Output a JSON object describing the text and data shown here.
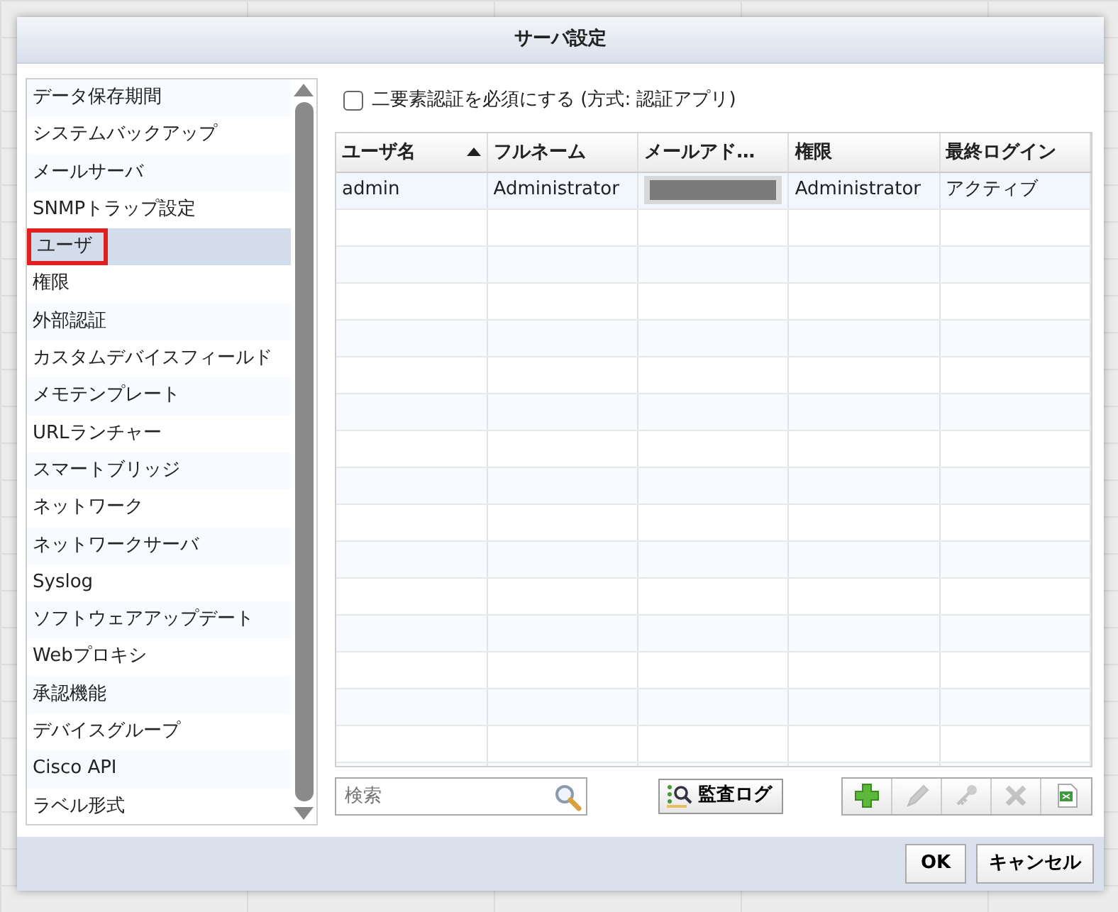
{
  "dialog": {
    "title": "サーバ設定"
  },
  "sidebar": {
    "items": [
      {
        "label": "データ保存期間",
        "selected": false,
        "annotated": false
      },
      {
        "label": "システムバックアップ",
        "selected": false,
        "annotated": false
      },
      {
        "label": "メールサーバ",
        "selected": false,
        "annotated": false
      },
      {
        "label": "SNMPトラップ設定",
        "selected": false,
        "annotated": false
      },
      {
        "label": "ユーザ",
        "selected": true,
        "annotated": true
      },
      {
        "label": "権限",
        "selected": false,
        "annotated": false
      },
      {
        "label": "外部認証",
        "selected": false,
        "annotated": false
      },
      {
        "label": "カスタムデバイスフィールド",
        "selected": false,
        "annotated": false
      },
      {
        "label": "メモテンプレート",
        "selected": false,
        "annotated": false
      },
      {
        "label": "URLランチャー",
        "selected": false,
        "annotated": false
      },
      {
        "label": "スマートブリッジ",
        "selected": false,
        "annotated": false
      },
      {
        "label": "ネットワーク",
        "selected": false,
        "annotated": false
      },
      {
        "label": "ネットワークサーバ",
        "selected": false,
        "annotated": false
      },
      {
        "label": "Syslog",
        "selected": false,
        "annotated": false
      },
      {
        "label": "ソフトウェアアップデート",
        "selected": false,
        "annotated": false
      },
      {
        "label": "Webプロキシ",
        "selected": false,
        "annotated": false
      },
      {
        "label": "承認機能",
        "selected": false,
        "annotated": false
      },
      {
        "label": "デバイスグループ",
        "selected": false,
        "annotated": false
      },
      {
        "label": "Cisco API",
        "selected": false,
        "annotated": false
      },
      {
        "label": "ラベル形式",
        "selected": false,
        "annotated": false
      }
    ]
  },
  "two_factor": {
    "label": "二要素認証を必須にする (方式: 認証アプリ)",
    "checked": false
  },
  "table": {
    "columns": [
      {
        "label": "ユーザ名",
        "sorted": true
      },
      {
        "label": "フルネーム",
        "sorted": false
      },
      {
        "label": "メールアド…",
        "sorted": false
      },
      {
        "label": "権限",
        "sorted": false
      },
      {
        "label": "最終ログイン",
        "sorted": false
      }
    ],
    "rows": [
      {
        "cells": [
          {
            "kind": "text",
            "text": "admin"
          },
          {
            "kind": "text",
            "text": "Administrator"
          },
          {
            "kind": "redacted"
          },
          {
            "kind": "text",
            "text": "Administrator"
          },
          {
            "kind": "text",
            "text": "アクティブ"
          }
        ]
      }
    ]
  },
  "search": {
    "placeholder": "検索"
  },
  "audit_button": {
    "label": "監査ログ"
  },
  "toolbar_buttons": [
    {
      "kind": "add",
      "disabled": false
    },
    {
      "kind": "edit",
      "disabled": true
    },
    {
      "kind": "key",
      "disabled": true
    },
    {
      "kind": "delete",
      "disabled": true
    },
    {
      "kind": "export",
      "disabled": false
    }
  ],
  "footer_buttons": [
    {
      "label": "OK"
    },
    {
      "label": "キャンセル"
    }
  ]
}
